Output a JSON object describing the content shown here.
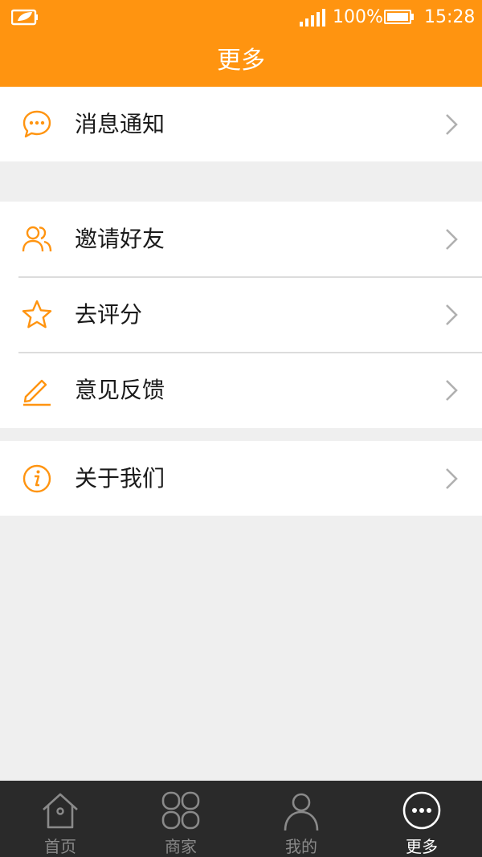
{
  "status_bar": {
    "battery_percent": "100%",
    "time": "15:28"
  },
  "header": {
    "title": "更多"
  },
  "menu": {
    "message_notice": "消息通知",
    "invite_friends": "邀请好友",
    "rate": "去评分",
    "feedback": "意见反馈",
    "about_us": "关于我们"
  },
  "tabs": [
    {
      "label": "首页",
      "icon": "home-icon",
      "active": false
    },
    {
      "label": "商家",
      "icon": "merchants-icon",
      "active": false
    },
    {
      "label": "我的",
      "icon": "profile-icon",
      "active": false
    },
    {
      "label": "更多",
      "icon": "more-icon",
      "active": true
    }
  ],
  "colors": {
    "accent": "#ff9410",
    "background": "#efefef",
    "tabbar": "#2a2a2a"
  }
}
